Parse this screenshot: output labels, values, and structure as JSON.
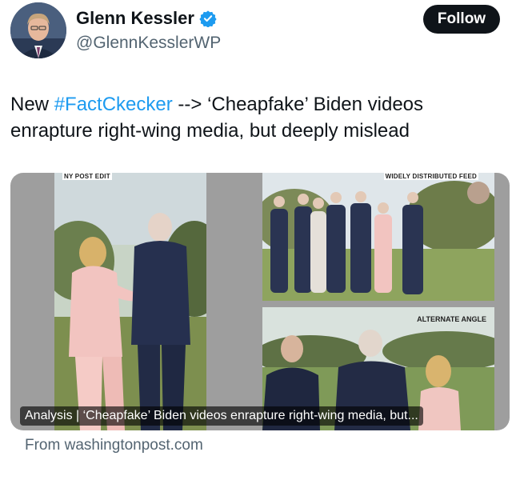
{
  "author": {
    "name": "Glenn Kessler",
    "handle": "@GlennKesslerWP",
    "verified": true,
    "avatar_icon": "profile-photo"
  },
  "follow_label": "Follow",
  "tweet": {
    "prefix": "New ",
    "hashtag": "#FactCkecker",
    "body": " --> ‘Cheapfake’ Biden videos enrapture right-wing media, but deeply mislead"
  },
  "card": {
    "left_label": "NY POST EDIT",
    "right_top_label": "WIDELY DISTRIBUTED FEED",
    "right_bottom_label": "ALTERNATE ANGLE",
    "caption": "Analysis | ‘Cheapfake’ Biden videos enrapture right-wing media, but...",
    "source": "From washingtonpost.com"
  },
  "colors": {
    "accent": "#1d9bf0",
    "text": "#0f1419",
    "secondary": "#536471",
    "follow_bg": "#0f1419"
  }
}
